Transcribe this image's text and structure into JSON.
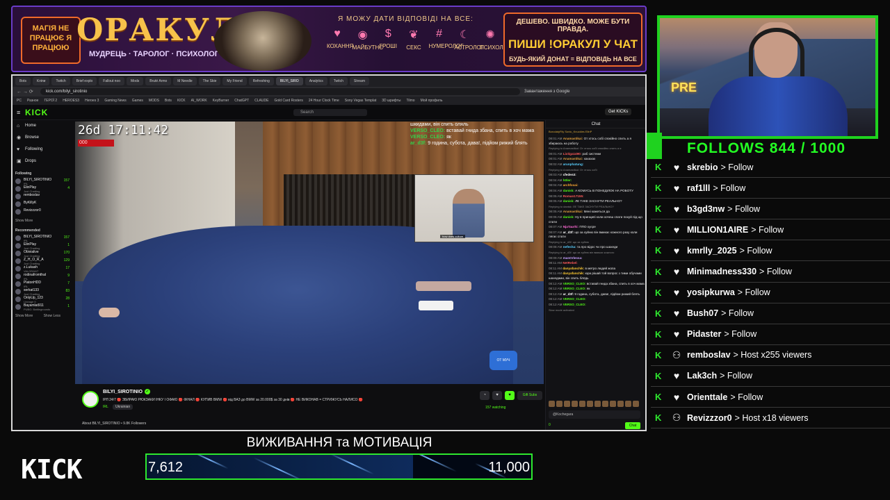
{
  "banner": {
    "magic_text": "МАГІЯ НЕ ПРАЦЮЄ Я ПРАЦЮЮ",
    "title": "ОРАКУЛ",
    "subtitle": "МУДРЕЦЬ · ТАРОЛОГ · ПСИХОЛОГ",
    "ask_line": "Я МОЖУ ДАТИ ВІДПОВІДІ НА ВСЕ:",
    "topics": [
      "КОХАННЯ",
      "МАЙБУТНЄ",
      "ГРОШІ",
      "СЕКС",
      "НУМЕРОЛОГ",
      "АСТРОЛОГ",
      "ПСИХОЛОГ"
    ],
    "cta_line1": "ДЕШЕВО. ШВИДКО. МОЖЕ БУТИ ПРАВДА.",
    "cta_line2": "ПИШИ !ОРАКУЛ У ЧАТ",
    "cta_line3": "БУДЬ-ЯКИЙ ДОНАТ = ВІДПОВІДЬ НА ВСЕ"
  },
  "browser": {
    "tabs": [
      "Bots",
      "Кліпи",
      "Twitch",
      "Brief explo",
      "Fallout noo",
      "Mods",
      "Bruté Armo",
      "M Needle",
      "The Skie",
      "My Friend",
      "Refreshing",
      "BILYI_SIRO",
      "Analytics",
      "Twitch",
      "Stream"
    ],
    "url": "kick.com/bilyi_sirotinio",
    "url_right": "Завантаження з Google",
    "bookmarks": [
      "PC",
      "Разное",
      "ГЕРОЇ 2",
      "HEROES3",
      "Heroes 3",
      "Gaming News",
      "Games",
      "MODS",
      "Bots",
      "KICK",
      "AI_WORK",
      "KeyBurner",
      "ChatGPT",
      "CLAUDE",
      "Gold Card Rosters",
      "24 Hour Clock Time",
      "Sony Vegas Templat",
      "3D шрифты",
      "Tilmo",
      "Мой профиль"
    ]
  },
  "kick": {
    "logo": "KICK",
    "search_placeholder": "Search",
    "get_kicks": "Get KICKs",
    "nav": [
      {
        "icon": "⌂",
        "label": "Home"
      },
      {
        "icon": "◉",
        "label": "Browse"
      },
      {
        "icon": "♥",
        "label": "Following"
      },
      {
        "icon": "▣",
        "label": "Drops"
      }
    ],
    "following_label": "Following",
    "following": [
      {
        "name": "BILYI_SIROTINIO",
        "category": "IRL",
        "viewers": "157"
      },
      {
        "name": "ElinPlay",
        "category": "Just Chatting",
        "viewers": "4"
      },
      {
        "name": "remboslav",
        "category": "",
        "viewers": ""
      },
      {
        "name": "ByKillyK",
        "category": "",
        "viewers": ""
      },
      {
        "name": "Revizzzor0",
        "category": "",
        "viewers": ""
      }
    ],
    "show_more": "Show More",
    "recommended_label": "Recommended",
    "recommended": [
      {
        "name": "BILYI_SIROTINIO",
        "category": "IRL",
        "viewers": "157"
      },
      {
        "name": "ElinPlay",
        "category": "Just Chatting",
        "viewers": "1"
      },
      {
        "name": "Obivialive",
        "category": "Just Chatting",
        "viewers": "170"
      },
      {
        "name": "Z_H_O_R_A",
        "category": "Just Chatting",
        "viewers": "129"
      },
      {
        "name": "z.Lukash",
        "category": "VALORANT",
        "viewers": "17"
      },
      {
        "name": "rodinafromthal",
        "category": "IRL",
        "viewers": "9"
      },
      {
        "name": "PlatonHDD",
        "category": "IRL",
        "viewers": "7"
      },
      {
        "name": "serkat133",
        "category": "Just Chatting",
        "viewers": "83"
      },
      {
        "name": "OnlyUp_123",
        "category": "Lineage II",
        "viewers": "28"
      },
      {
        "name": "Bayamlat911",
        "category": "PUBG: Battlegrounds",
        "viewers": "1"
      }
    ],
    "show_more_2": "Show More",
    "show_less": "Show Less"
  },
  "video": {
    "timestamp": "26d 17:11:42",
    "red_label": "000",
    "pip_caption": "how does culture",
    "sticker": "ОТ МУЧ",
    "overlay_chat": [
      {
        "user": "",
        "text": "шкидами, він спить оляль"
      },
      {
        "user": "VERSO_CLEO:",
        "text": "вставай гнида збана, спить в хоч мама"
      },
      {
        "user": "VERSO_CLEO:",
        "text": "як"
      },
      {
        "user": "ar_d3f:",
        "text": "9 година, субота, дава!, підйом рижий блять"
      }
    ]
  },
  "stream_info": {
    "name": "BILYI_SIROTINIO",
    "title": "ІРЛ 24/7 🔴 ЗБИРАЮ РЮКЗАКИ ІНКУ І ОФАЮ 🔴 ФІНАЛ 🔴 КУПИВ BMW 🔴 від ВАЗ до BMW за 20.000$ за 30 днів 🔴 НЕ ВИКОНАВ = СТРИЖУСЬ НАЛИСО 🔴",
    "category": "IRL",
    "language": "Ukrainian",
    "gift_subs": "Gift Subs",
    "watching": "157 watching",
    "about": "About BILYI_SIROTINIO • 9.8K Followers"
  },
  "chat": {
    "header": "Chat",
    "pinned": "BorodatyFily  Sonic_Knuckles  EllnP",
    "messages": [
      {
        "time": "08:01 AM",
        "user": "Anamastikai:",
        "color": "#e0a040",
        "text": "От хтось собі спокійно спить а я збираюсь на роботу"
      },
      {
        "time": "",
        "user": "",
        "color": "",
        "text": "Replying to Anamastikai: От хтось собі спокійно спить а я"
      },
      {
        "time": "08:01 AM",
        "user": "Lictiga1490:",
        "color": "#ff5a5a",
        "text": "раб системи"
      },
      {
        "time": "08:01 AM",
        "user": "Anamastikai:",
        "color": "#e0a040",
        "text": "хахахах"
      },
      {
        "time": "08:02 AM",
        "user": "arunphatung:",
        "color": "#5ad0ff",
        "text": ""
      },
      {
        "time": "",
        "user": "",
        "color": "",
        "text": "Replying to Anamastikai: От хтось собі"
      },
      {
        "time": "08:03 AM",
        "user": "cfeden3:",
        "color": "#ffffff",
        "text": ""
      },
      {
        "time": "08:04 AM",
        "user": "h0ler:",
        "color": "#53fc18",
        "text": ""
      },
      {
        "time": "08:04 AM",
        "user": "archfoxai:",
        "color": "#ffaa33",
        "text": ""
      },
      {
        "time": "08:04 AM",
        "user": "danisk:",
        "color": "#53fc18",
        "text": "А КОМУСЬ В ПОНЕДІЛОК НА РОБОТУ"
      },
      {
        "time": "08:05 AM",
        "user": "Roman17155:",
        "color": "#ff5a5a",
        "text": ""
      },
      {
        "time": "08:05 AM",
        "user": "danisk:",
        "color": "#53fc18",
        "text": "ЛЕ ТАКЕ ЗАСНУТИ РЕАЛЬНО?"
      },
      {
        "time": "",
        "user": "",
        "color": "",
        "text": "Replying to danisk: ЛЕ ТАКЕ ЗАСНУТИ РЕАЛЬНО?"
      },
      {
        "time": "08:05 AM",
        "user": "Anamastikai:",
        "color": "#e0a040",
        "text": "Мені кажеться да"
      },
      {
        "time": "08:06 AM",
        "user": "danisk:",
        "color": "#53fc18",
        "text": "Ну в принципі коли хочеш спати похуй під що спати"
      },
      {
        "time": "08:07 AM",
        "user": "NjaTaurhi:",
        "color": "#ff6ad5",
        "text": "ППО хуєре"
      },
      {
        "time": "08:07 AM",
        "user": "ar_d3f:",
        "color": "#ffffff",
        "text": "що за хуйню він вмикає кожного разу коли лягає спати"
      },
      {
        "time": "",
        "user": "",
        "color": "",
        "text": "Replying to ar_d3f: що за хуйню"
      },
      {
        "time": "08:08 AM",
        "user": "nefesha:",
        "color": "#5ad0ff",
        "text": "та про відос чи про шахеди"
      },
      {
        "time": "",
        "user": "",
        "color": "",
        "text": "Replying to ar_d3f: що за хуйню він вмикає кожного"
      },
      {
        "time": "08:09 AM",
        "user": "manOrlessa:",
        "color": "#c8a0ff",
        "text": ""
      },
      {
        "time": "08:11 AM",
        "user": "NetRebel:",
        "color": "#ff5a5a",
        "text": ""
      },
      {
        "time": "08:11 AM",
        "user": "danyafanchik:",
        "color": "#ffcc33",
        "text": "в метро людей жопа"
      },
      {
        "time": "08:11 AM",
        "user": "danyafanchik:",
        "color": "#ffcc33",
        "text": "юра рішай той вопрос з тими обучами шахедами, він спить блядь"
      },
      {
        "time": "08:12 AM",
        "user": "VERSO_CLEO:",
        "color": "#53fc18",
        "text": "вставай гнида збана, спить в хоч мама"
      },
      {
        "time": "08:12 AM",
        "user": "VERSO_CLEO:",
        "color": "#53fc18",
        "text": "як"
      },
      {
        "time": "08:12 AM",
        "user": "ar_d3f:",
        "color": "#ffffff",
        "text": "9 година, субота, дава!, підйом рижий блять"
      },
      {
        "time": "08:12 AM",
        "user": "VERSO_CLEO:",
        "color": "#53fc18",
        "text": ""
      },
      {
        "time": "08:12 AM",
        "user": "VERSO_CLEO:",
        "color": "#53fc18",
        "text": ""
      },
      {
        "time": "",
        "user": "",
        "color": "",
        "text": "Slow mode activated"
      }
    ],
    "input_placeholder": "@Kochegara",
    "count": "0",
    "send": "Chat"
  },
  "follows": {
    "title": "FOLLOWS 844 / 1000",
    "items": [
      {
        "icon": "heart-icon",
        "user": "skrebio",
        "action": "> Follow"
      },
      {
        "icon": "heart-icon",
        "user": "raf1lll",
        "action": "> Follow"
      },
      {
        "icon": "heart-icon",
        "user": "b3gd3nw",
        "action": "> Follow"
      },
      {
        "icon": "heart-icon",
        "user": "MILLION1AIRE",
        "action": "> Follow"
      },
      {
        "icon": "heart-icon",
        "user": "kmrlly_2025",
        "action": "> Follow"
      },
      {
        "icon": "heart-icon",
        "user": "Minimadness330",
        "action": "> Follow"
      },
      {
        "icon": "heart-icon",
        "user": "yosipkurwa",
        "action": "> Follow"
      },
      {
        "icon": "heart-icon",
        "user": "Bush07",
        "action": "> Follow"
      },
      {
        "icon": "heart-icon",
        "user": "Pidaster",
        "action": "> Follow"
      },
      {
        "icon": "people-icon",
        "user": "remboslav",
        "action": "> Host x255 viewers"
      },
      {
        "icon": "heart-icon",
        "user": "Lak3ch",
        "action": "> Follow"
      },
      {
        "icon": "heart-icon",
        "user": "Orienttale",
        "action": "> Follow"
      },
      {
        "icon": "people-icon",
        "user": "Revizzzor0",
        "action": "> Host x18 viewers"
      }
    ]
  },
  "goal": {
    "logo": "KICK",
    "title": "ВИЖИВАННЯ та МОТИВАЦІЯ",
    "current": "7,612",
    "target": "11,000",
    "progress": 0.692
  },
  "colors": {
    "kick_green": "#53fc18",
    "banner_border": "#6a3cc8",
    "goal_border": "#2ee82e"
  }
}
